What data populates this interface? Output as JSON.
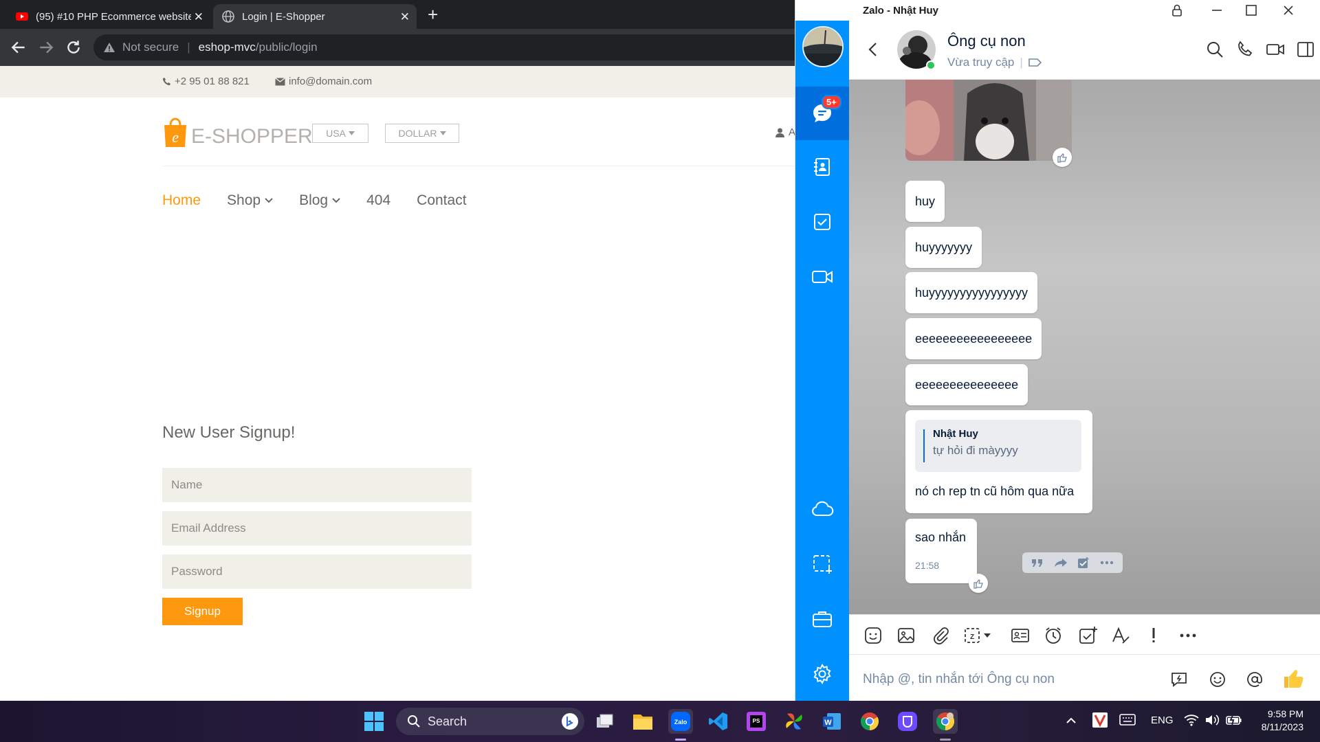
{
  "browser": {
    "tabs": [
      {
        "title": "(95) #10 PHP Ecommerce website",
        "favicon": "youtube-icon",
        "close": "✕"
      },
      {
        "title": "Login | E-Shopper",
        "favicon": "globe-icon",
        "close": "✕"
      }
    ],
    "new_tab": "+",
    "address": {
      "security": "Not secure",
      "host": "eshop-mvc",
      "path": "/public/login"
    }
  },
  "webpage": {
    "topbar": {
      "phone": "+2 95 01 88 821",
      "email": "info@domain.com"
    },
    "logo_text": "E-SHOPPER",
    "country_dropdown": "USA",
    "currency_dropdown": "DOLLAR",
    "account_partial": "A",
    "nav": [
      {
        "label": "Home",
        "active": true
      },
      {
        "label": "Shop",
        "dropdown": true
      },
      {
        "label": "Blog",
        "dropdown": true
      },
      {
        "label": "404"
      },
      {
        "label": "Contact"
      }
    ],
    "signup": {
      "title": "New User Signup!",
      "name_placeholder": "Name",
      "email_placeholder": "Email Address",
      "password_placeholder": "Password",
      "button": "Signup"
    },
    "colors": {
      "accent": "#fe980f",
      "text": "#696763",
      "field": "#f0f0e9"
    }
  },
  "zalo": {
    "window_title": "Zalo - Nhật Huy",
    "unread_badge": "5+",
    "contact": {
      "name": "Ông cụ non",
      "status": "Vừa truy cập"
    },
    "messages": [
      {
        "text": "huy"
      },
      {
        "text": "huyyyyyyy"
      },
      {
        "text": "huyyyyyyyyyyyyyyyy"
      },
      {
        "text": "eeeeeeeeeeeeeeeee"
      },
      {
        "text": "eeeeeeeeeeeeeee"
      },
      {
        "quote_author": "Nhật Huy",
        "quote_text": "tự hỏi đi màyyyy",
        "text": "nó ch rep tn cũ hôm qua nữa"
      },
      {
        "text": "sao nhắn",
        "time": "21:58"
      }
    ],
    "input_placeholder": "Nhập @, tin nhắn tới Ông cụ non",
    "colors": {
      "sidebar": "#0091ff",
      "sidebar_active": "#006edc",
      "badge": "#ff3b30"
    }
  },
  "taskbar": {
    "search_label": "Search",
    "tray": {
      "language": "ENG",
      "time": "9:58 PM",
      "date": "8/11/2023"
    }
  }
}
